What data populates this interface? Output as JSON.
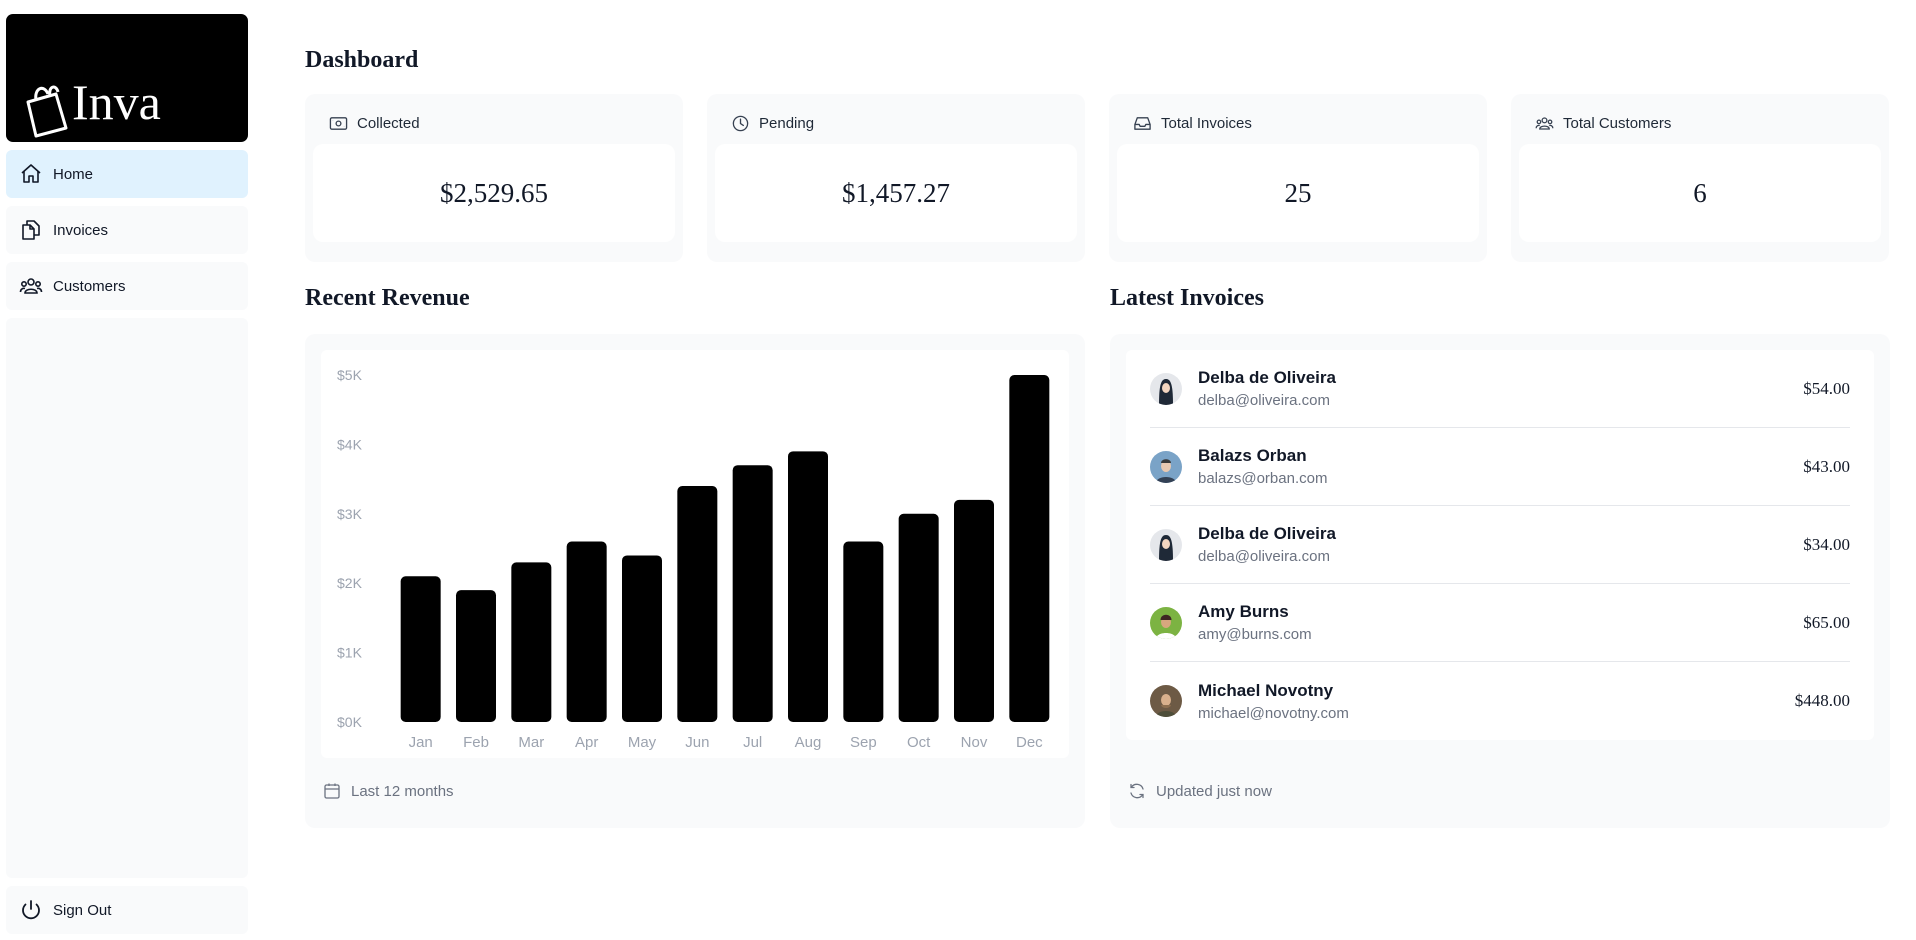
{
  "app": {
    "brand": "Inva"
  },
  "sidebar": {
    "items": [
      {
        "label": "Home",
        "icon": "home-icon",
        "active": true
      },
      {
        "label": "Invoices",
        "icon": "documents-icon",
        "active": false
      },
      {
        "label": "Customers",
        "icon": "users-icon",
        "active": false
      }
    ],
    "signout": "Sign Out"
  },
  "page": {
    "title": "Dashboard"
  },
  "cards": [
    {
      "label": "Collected",
      "value": "$2,529.65",
      "icon": "banknote-icon"
    },
    {
      "label": "Pending",
      "value": "$1,457.27",
      "icon": "clock-icon"
    },
    {
      "label": "Total Invoices",
      "value": "25",
      "icon": "inbox-icon"
    },
    {
      "label": "Total Customers",
      "value": "6",
      "icon": "users-icon"
    }
  ],
  "revenue": {
    "title": "Recent Revenue",
    "footer": "Last 12 months"
  },
  "chart_data": {
    "type": "bar",
    "categories": [
      "Jan",
      "Feb",
      "Mar",
      "Apr",
      "May",
      "Jun",
      "Jul",
      "Aug",
      "Sep",
      "Oct",
      "Nov",
      "Dec"
    ],
    "values": [
      2100,
      1900,
      2300,
      2600,
      2400,
      3400,
      3700,
      3900,
      2600,
      3000,
      3200,
      5000
    ],
    "ylim": [
      0,
      5000
    ],
    "yticks": [
      "$0K",
      "$1K",
      "$2K",
      "$3K",
      "$4K",
      "$5K"
    ],
    "colors": {
      "bar": "#000000",
      "tick": "#9ca3af"
    }
  },
  "invoices": {
    "title": "Latest Invoices",
    "footer": "Updated just now",
    "rows": [
      {
        "name": "Delba de Oliveira",
        "email": "delba@oliveira.com",
        "amount": "$54.00"
      },
      {
        "name": "Balazs Orban",
        "email": "balazs@orban.com",
        "amount": "$43.00"
      },
      {
        "name": "Delba de Oliveira",
        "email": "delba@oliveira.com",
        "amount": "$34.00"
      },
      {
        "name": "Amy Burns",
        "email": "amy@burns.com",
        "amount": "$65.00"
      },
      {
        "name": "Michael Novotny",
        "email": "michael@novotny.com",
        "amount": "$448.00"
      }
    ]
  }
}
